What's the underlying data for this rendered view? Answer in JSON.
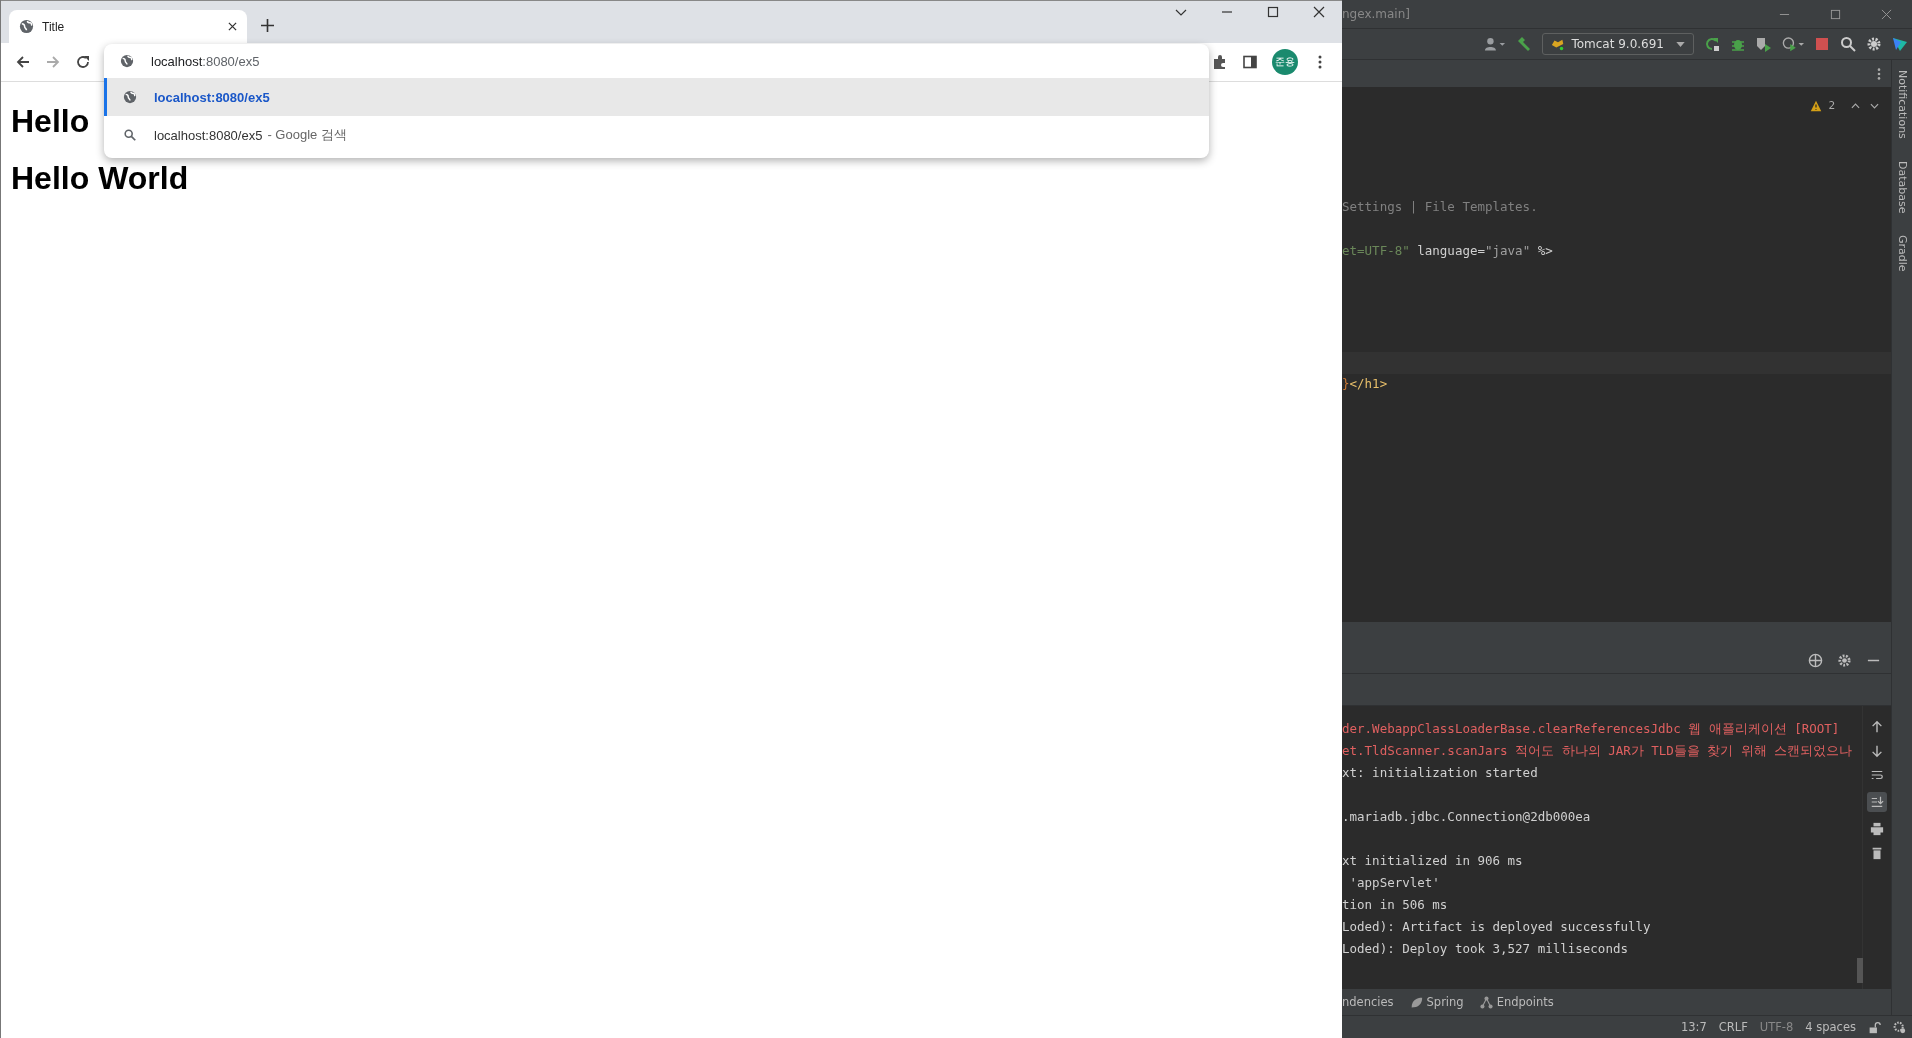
{
  "browser": {
    "tab": {
      "title": "Title"
    },
    "address": {
      "host": "localhost",
      "rest": ":8080/ex5"
    },
    "avatar": "준용",
    "suggestions": [
      {
        "kind": "url",
        "text": "localhost:8080/ex5",
        "selected": true
      },
      {
        "kind": "search",
        "text": "localhost:8080/ex5",
        "suffix": "- Google 검색",
        "selected": false
      }
    ],
    "headings": [
      "Hello",
      "Hello World"
    ]
  },
  "ide": {
    "title": "ngex.main]",
    "run_config": "Tomcat 9.0.691",
    "warnings": "2",
    "side_tools": [
      "Notifications",
      "Database",
      "Gradle"
    ],
    "editor_lines": [
      {
        "segments": [
          {
            "kind": "comment",
            "text": "Settings | File Templates."
          }
        ]
      },
      {
        "segments": [
          {
            "kind": "string",
            "text": "et=UTF-8\""
          },
          {
            "kind": "plain",
            "text": " language="
          },
          {
            "kind": "value",
            "text": "\"java\""
          },
          {
            "kind": "plain",
            "text": " %>"
          }
        ]
      },
      {
        "segments": [
          {
            "kind": "brace",
            "text": "}"
          },
          {
            "kind": "tag",
            "text": "</h1>"
          }
        ]
      }
    ],
    "console_lines": [
      {
        "kind": "error",
        "text": "der.WebappClassLoaderBase.clearReferencesJdbc 웹 애플리케이션 [ROOT]"
      },
      {
        "kind": "error",
        "text": "et.TldScanner.scanJars 적어도 하나의 JAR가 TLD들을 찾기 위해 스캔되었으나"
      },
      {
        "kind": "info",
        "text": "xt: initialization started"
      },
      {
        "kind": "info",
        "text": ".mariadb.jdbc.Connection@2db000ea"
      },
      {
        "kind": "info",
        "text": "xt initialized in 906 ms"
      },
      {
        "kind": "info",
        "text": " 'appServlet'"
      },
      {
        "kind": "info",
        "text": "tion in 506 ms"
      },
      {
        "kind": "info",
        "text": "Loded): Artifact is deployed successfully"
      },
      {
        "kind": "info",
        "text": "Loded): Deploy took 3,527 milliseconds"
      }
    ],
    "tool_tabs": [
      {
        "kind": "plain",
        "label": "ndencies"
      },
      {
        "kind": "spring",
        "label": "Spring"
      },
      {
        "kind": "endpoints",
        "label": "Endpoints"
      }
    ],
    "status": [
      "13:7",
      "CRLF",
      "UTF-8",
      "4 spaces"
    ]
  }
}
